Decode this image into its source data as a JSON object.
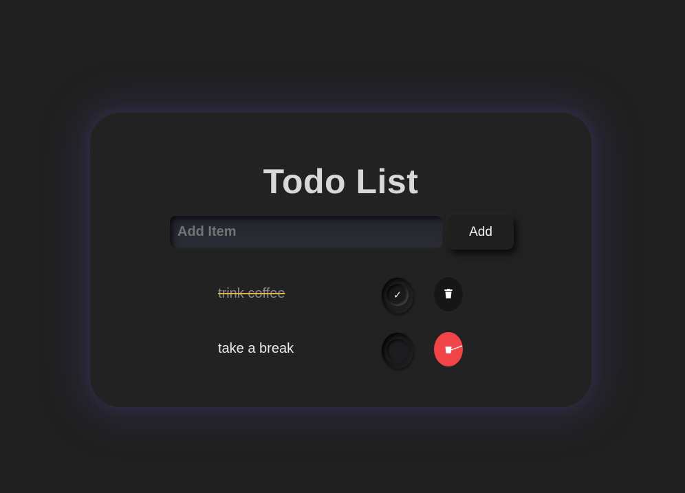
{
  "app": {
    "title": "Todo List"
  },
  "add_form": {
    "placeholder": "Add Item",
    "value": "",
    "button_label": "Add"
  },
  "todos": [
    {
      "text": "trink coffee",
      "done": true,
      "check_glyph": "✓"
    },
    {
      "text": "take a break",
      "done": false,
      "check_glyph": ""
    }
  ],
  "icons": {
    "check": "check-icon",
    "delete": "trash-icon"
  },
  "colors": {
    "background": "#202020",
    "card": "#222222",
    "glow": "#3a3864",
    "delete_active": "#f04448",
    "strike": "#d8b64a"
  }
}
